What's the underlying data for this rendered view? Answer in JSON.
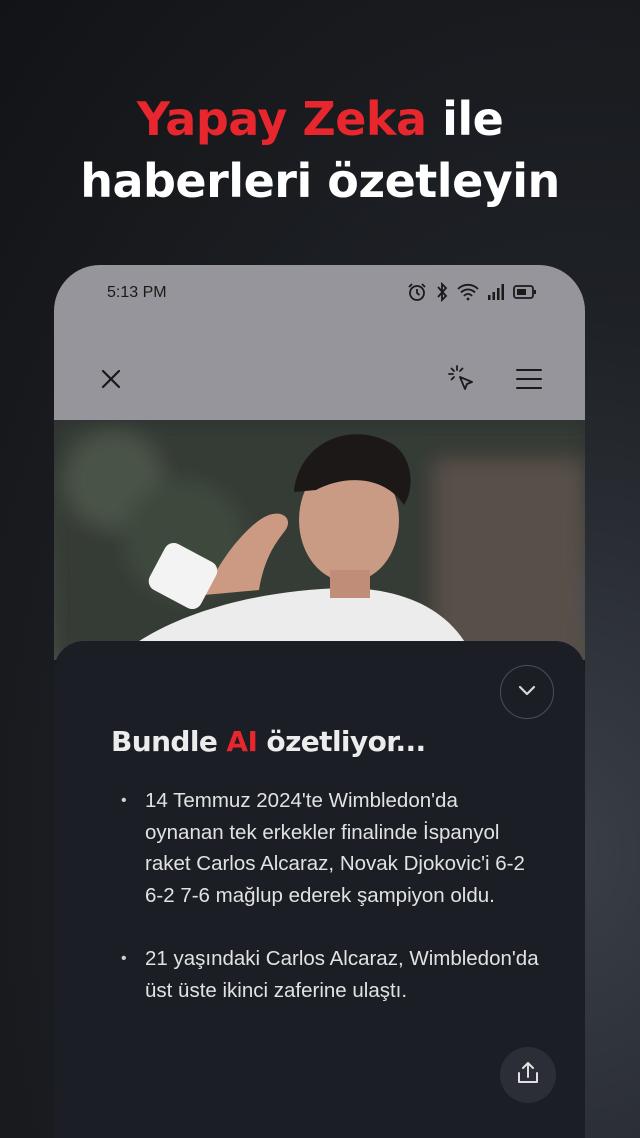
{
  "headline": {
    "accent": "Yapay Zeka",
    "line1_rest": " ile",
    "line2": "haberleri özetleyin"
  },
  "status_bar": {
    "time": "5:13 PM",
    "icons": [
      "alarm-icon",
      "bluetooth-icon",
      "wifi-icon",
      "signal-icon",
      "battery-icon"
    ]
  },
  "toolbar": {
    "icons": [
      "close-icon",
      "ai-sparkle-cursor-icon",
      "menu-icon"
    ]
  },
  "photo": {
    "description_icon": "article-photo"
  },
  "summary": {
    "title_prefix": "Bundle ",
    "title_ai": "AI",
    "title_suffix": " özetliyor...",
    "bullets": [
      "14 Temmuz 2024'te Wimbledon'da oynanan tek erkekler finalinde İspanyol raket Carlos Alcaraz, Novak Djokovic'i 6-2 6-2 7-6 mağlup ederek şampiyon oldu.",
      "21 yaşındaki Carlos Alcaraz, Wimbledon'da üst üste ikinci zaferine ulaştı."
    ]
  },
  "colors": {
    "accent": "#e8262d",
    "sheet_bg": "#1b1e25",
    "bar_bg": "#96959b"
  }
}
